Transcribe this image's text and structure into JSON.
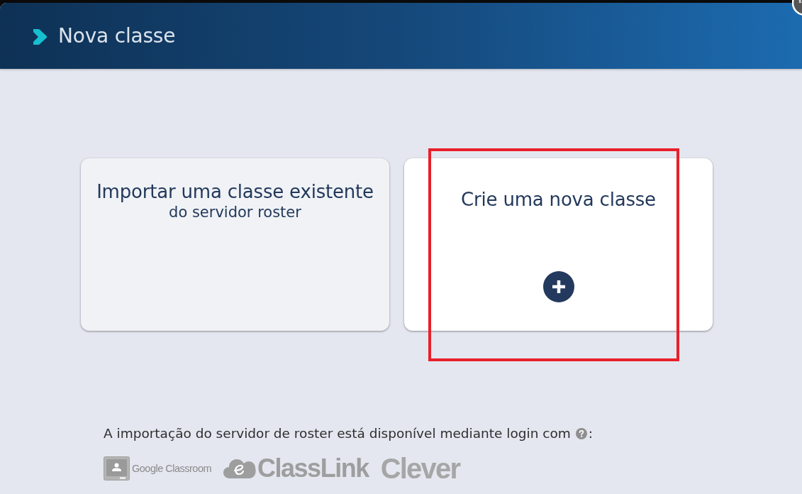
{
  "window": {
    "title": "Nova classe"
  },
  "options": [
    {
      "kind": "import",
      "title": "Importar uma classe existente",
      "subtitle": "do servidor roster",
      "disabled": true,
      "highlighted": false
    },
    {
      "kind": "create",
      "title": "Crie uma nova classe",
      "disabled": false,
      "highlighted": true
    }
  ],
  "footer": {
    "note": "A importação do servidor de roster está disponível mediante login com",
    "note_end": ":",
    "providers": [
      {
        "kind": "google-classroom",
        "name": "Google Classroom"
      },
      {
        "kind": "classlink",
        "name": "ClassLink"
      },
      {
        "kind": "clever",
        "name": "Clever"
      }
    ]
  }
}
